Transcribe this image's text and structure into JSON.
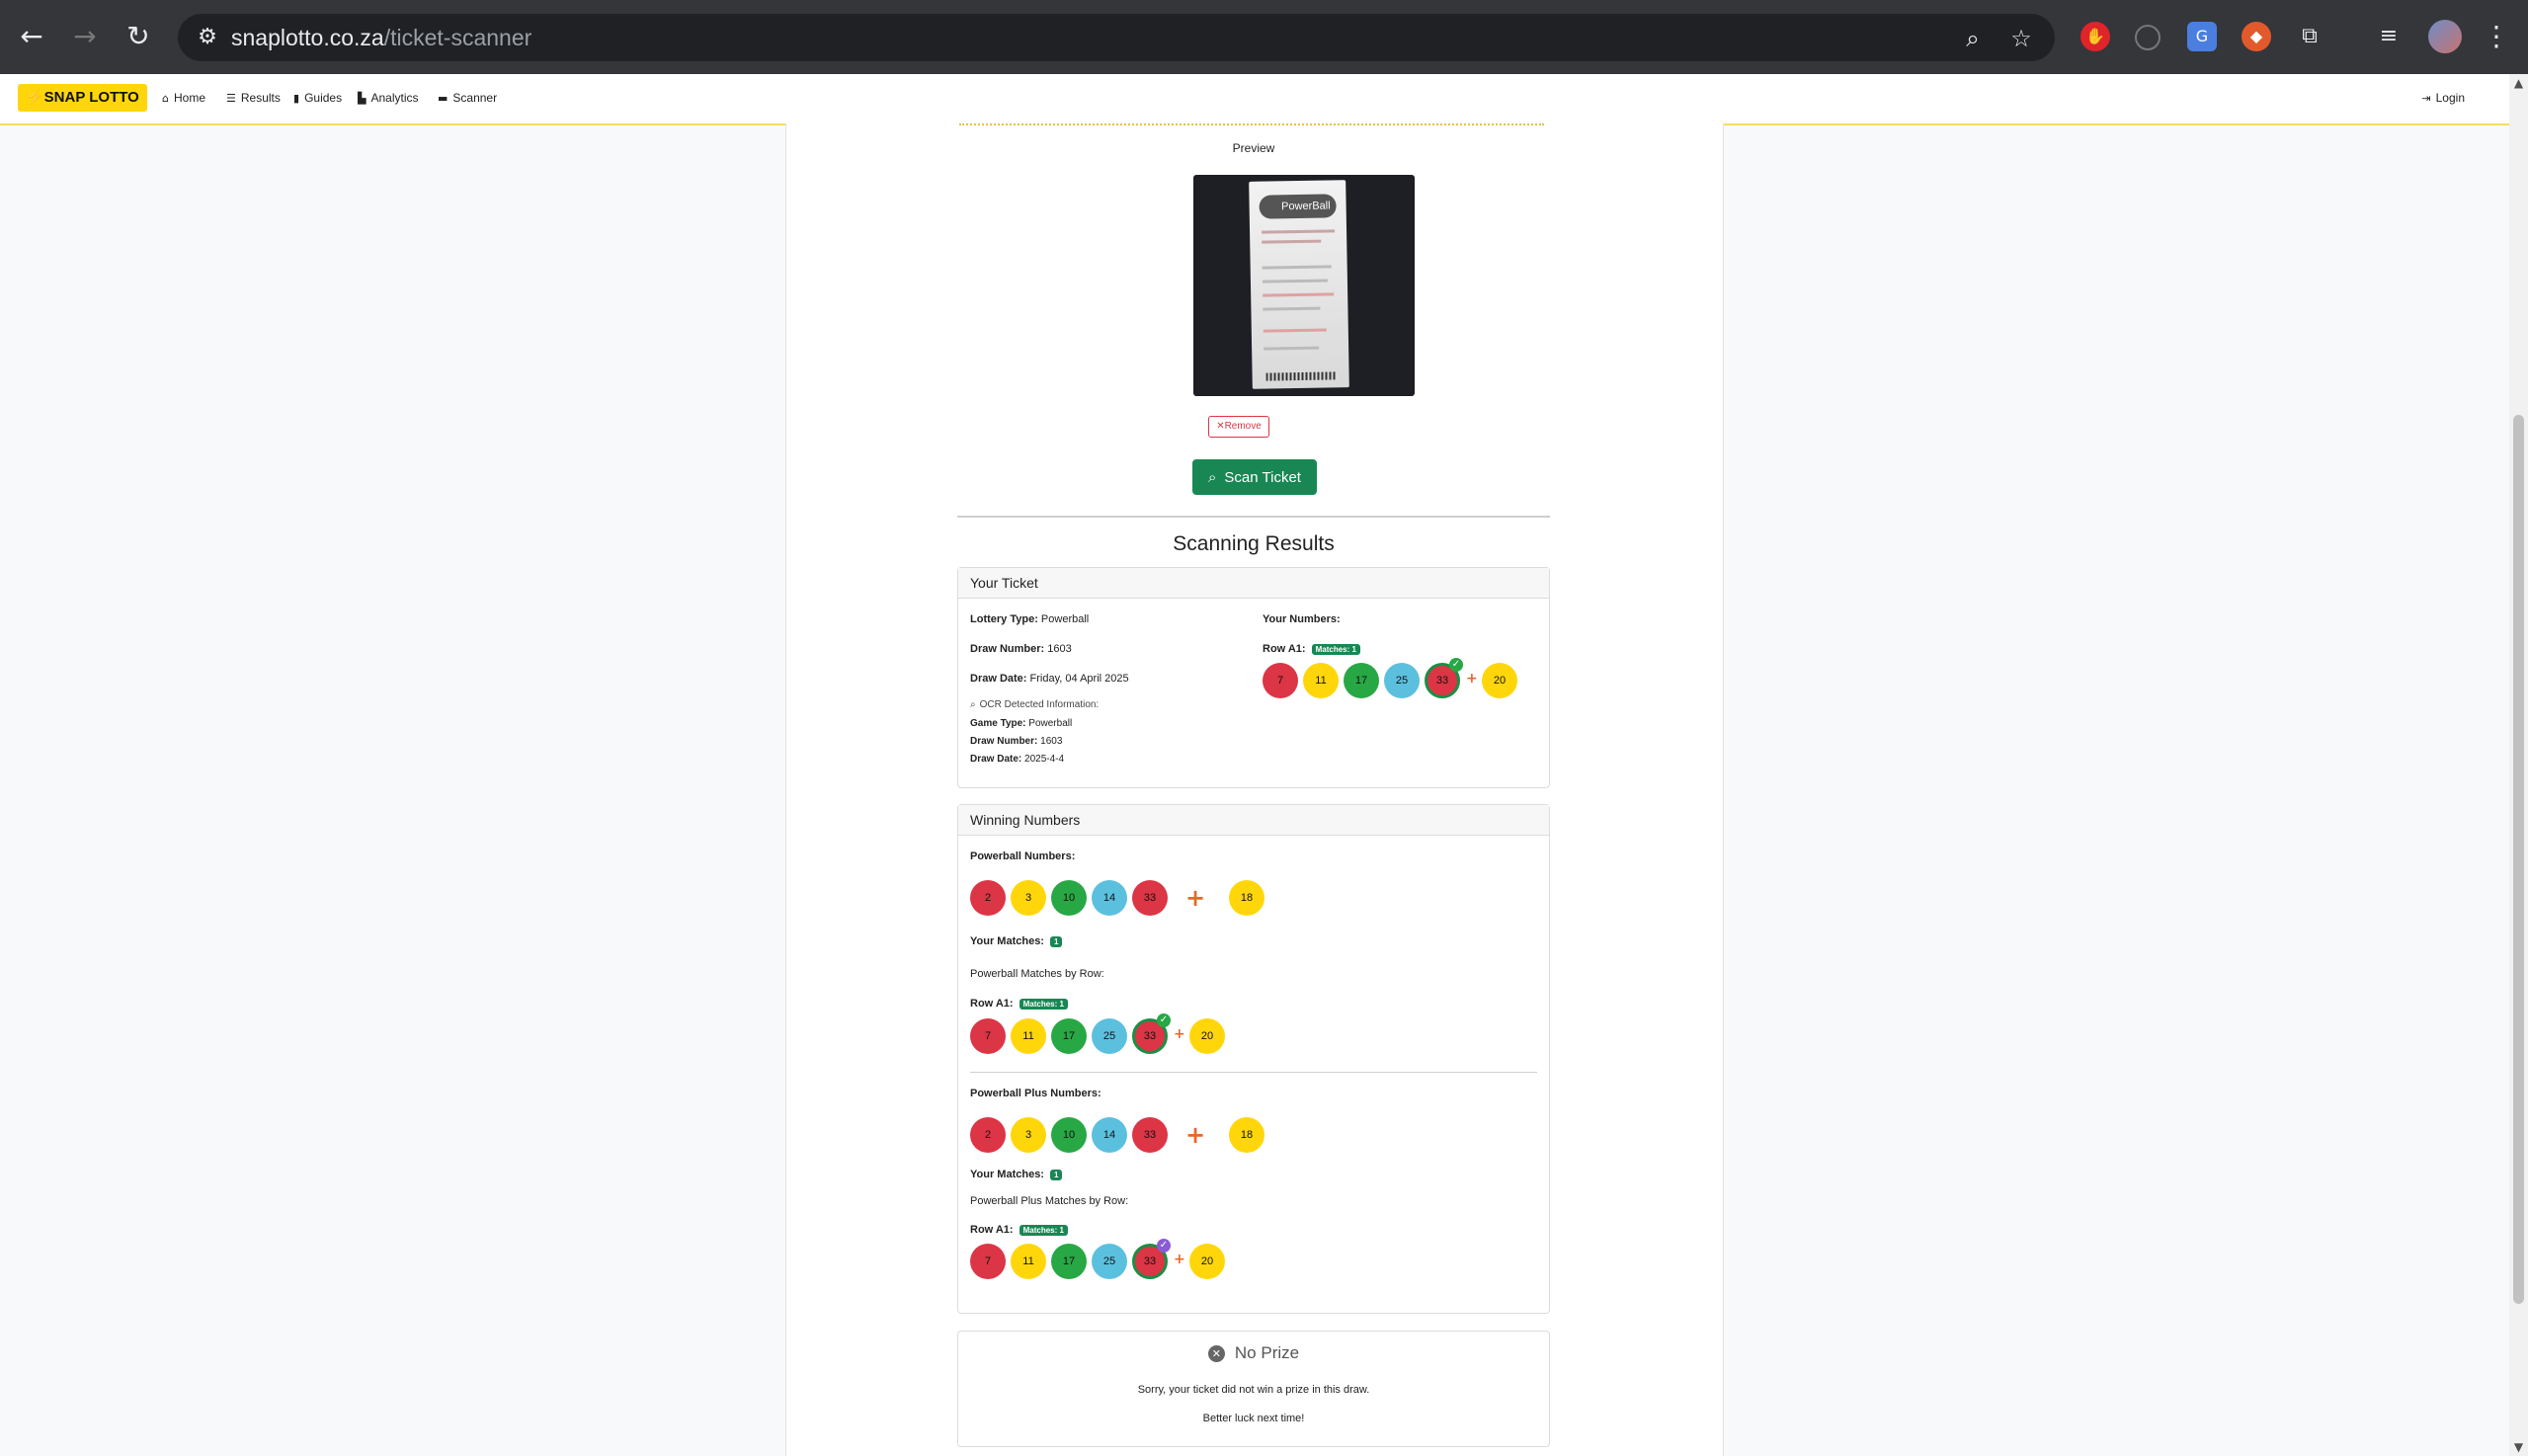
{
  "browser": {
    "url_host": "snaplotto.co.za",
    "url_path": "/ticket-scanner"
  },
  "navbar": {
    "brand": "⚡SNAP LOTTO",
    "links": [
      "Home",
      "Results",
      "Guides",
      "Analytics",
      "Scanner"
    ],
    "login": "Login"
  },
  "upload": {
    "preview_label": "Preview",
    "receipt_logo": "PowerBall",
    "remove_label": "✕Remove",
    "scan_label": "Scan Ticket"
  },
  "results": {
    "title": "Scanning Results",
    "ticket": {
      "header": "Your Ticket",
      "lottery_type_label": "Lottery Type:",
      "lottery_type": "Powerball",
      "draw_number_label": "Draw Number:",
      "draw_number": "1603",
      "draw_date_label": "Draw Date:",
      "draw_date": "Friday, 04 April 2025",
      "ocr_title": "OCR Detected Information:",
      "ocr_game_type_label": "Game Type:",
      "ocr_game_type": "Powerball",
      "ocr_draw_number_label": "Draw Number:",
      "ocr_draw_number": "1603",
      "ocr_draw_date_label": "Draw Date:",
      "ocr_draw_date": "2025-4-4",
      "your_numbers_label": "Your Numbers:",
      "row_label": "Row A1:",
      "row_badge": "Matches: 1",
      "numbers": [
        "7",
        "11",
        "17",
        "25",
        "33"
      ],
      "bonus": "20"
    },
    "winning": {
      "header": "Winning Numbers",
      "powerball_label": "Powerball Numbers:",
      "powerball_numbers": [
        "2",
        "3",
        "10",
        "14",
        "33"
      ],
      "powerball_bonus": "18",
      "your_matches_label": "Your Matches:",
      "powerball_matches": "1",
      "powerball_by_row_label": "Powerball Matches by Row:",
      "row_label": "Row A1:",
      "row_badge": "Matches: 1",
      "row_numbers": [
        "7",
        "11",
        "17",
        "25",
        "33"
      ],
      "row_bonus": "20",
      "plus_label": "Powerball Plus Numbers:",
      "plus_numbers": [
        "2",
        "3",
        "10",
        "14",
        "33"
      ],
      "plus_bonus": "18",
      "plus_matches": "1",
      "plus_by_row_label": "Powerball Plus Matches by Row:",
      "plus_row_numbers": [
        "7",
        "11",
        "17",
        "25",
        "33"
      ],
      "plus_row_bonus": "20"
    },
    "prize": {
      "title": "No Prize",
      "message": "Sorry, your ticket did not win a prize in this draw.",
      "note": "Better luck next time!"
    }
  },
  "colors": {
    "brand_yellow": "#ffd60a",
    "success_green": "#198754",
    "danger_red": "#dc3545",
    "ball_red": "#dc3545",
    "ball_yellow": "#ffd60a",
    "ball_green": "#28a745",
    "ball_blue": "#5bc0de"
  }
}
